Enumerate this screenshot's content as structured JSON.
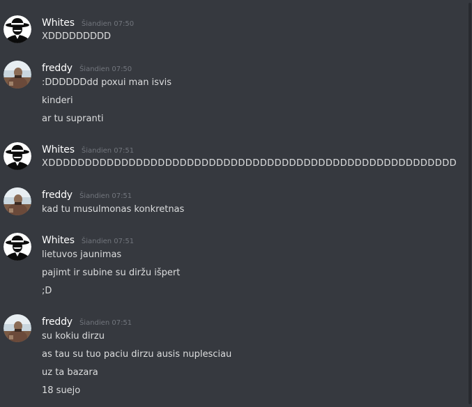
{
  "colors": {
    "background": "#36393f",
    "username": "#ffffff",
    "timestamp": "#72767d",
    "message": "#dcddde"
  },
  "messages": [
    {
      "author": "Whites",
      "avatar_icon": "hat-man-avatar-icon",
      "timestamp": "Šiandien 07:50",
      "lines": [
        "XDDDDDDDDD"
      ]
    },
    {
      "author": "freddy",
      "avatar_icon": "person-photo-avatar-icon",
      "timestamp": "Šiandien 07:50",
      "lines": [
        ":DDDDDDdd poxui man isvis",
        "kinderi",
        "ar tu supranti"
      ]
    },
    {
      "author": "Whites",
      "avatar_icon": "hat-man-avatar-icon",
      "timestamp": "Šiandien 07:51",
      "lines": [
        "XDDDDDDDDDDDDDDDDDDDDDDDDDDDDDDDDDDDDDDDDDDDDDDDDDDDDDDDD"
      ]
    },
    {
      "author": "freddy",
      "avatar_icon": "person-photo-avatar-icon",
      "timestamp": "Šiandien 07:51",
      "lines": [
        "kad tu musulmonas konkretnas"
      ]
    },
    {
      "author": "Whites",
      "avatar_icon": "hat-man-avatar-icon",
      "timestamp": "Šiandien 07:51",
      "lines": [
        "lietuvos jaunimas",
        "pajimt ir subine su diržu išpert",
        ";D"
      ]
    },
    {
      "author": "freddy",
      "avatar_icon": "person-photo-avatar-icon",
      "timestamp": "Šiandien 07:51",
      "lines": [
        "su kokiu dirzu",
        "as tau su tuo paciu dirzu ausis nuplesciau",
        "uz ta bazara",
        "18 suejo"
      ]
    }
  ]
}
